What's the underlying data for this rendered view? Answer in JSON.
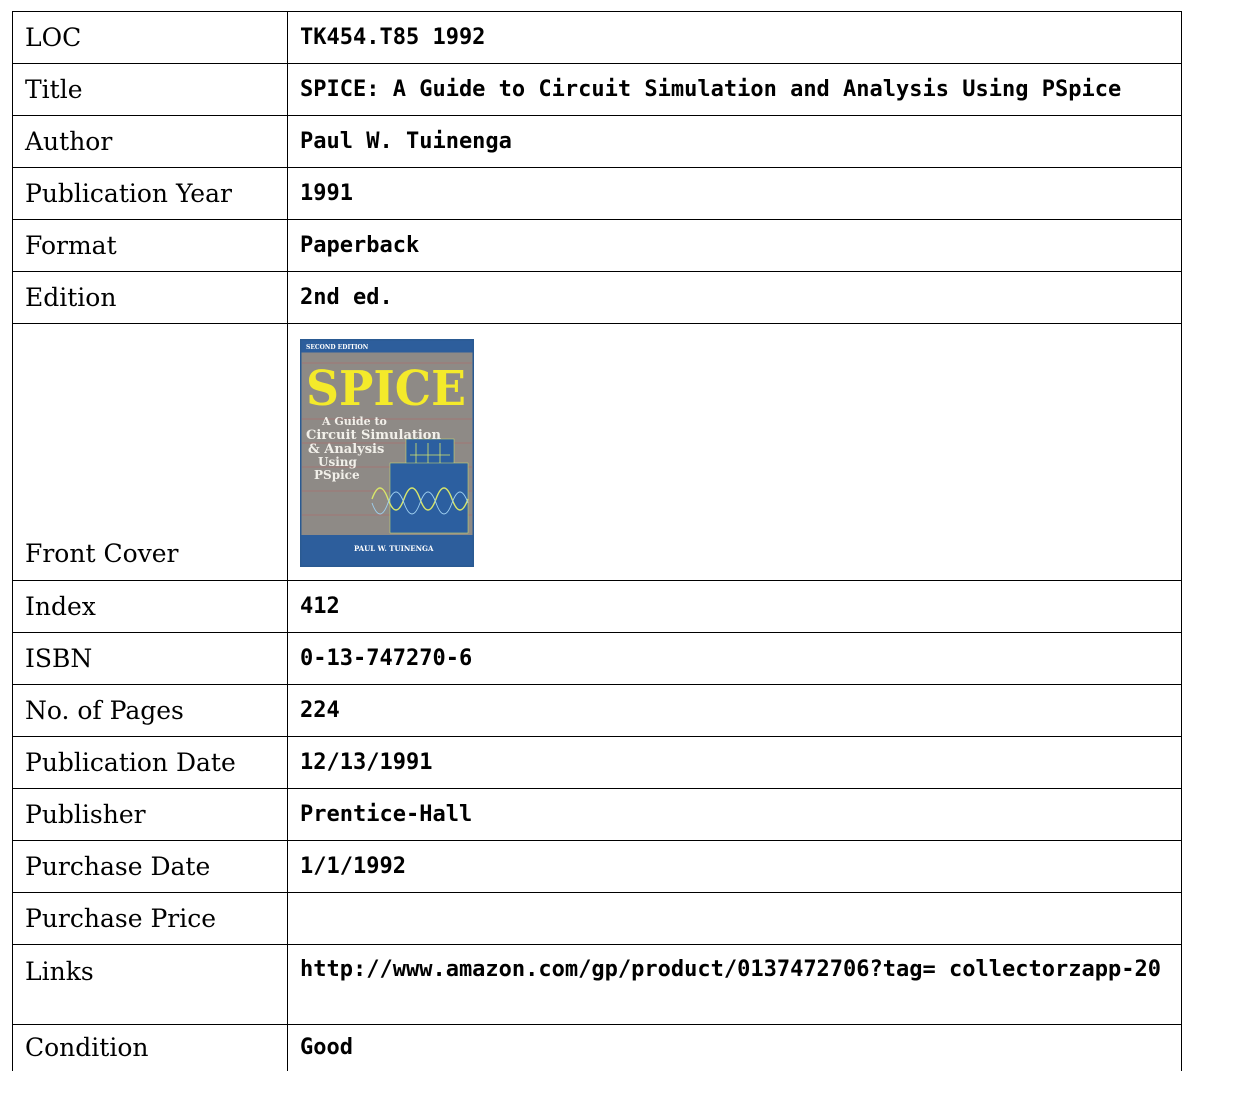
{
  "rows": [
    {
      "label": "LOC",
      "value": "TK454.T85 1992"
    },
    {
      "label": "Title",
      "value": "SPICE: A Guide to Circuit Simulation and Analysis Using PSpice"
    },
    {
      "label": "Author",
      "value": "Paul W. Tuinenga"
    },
    {
      "label": "Publication Year",
      "value": "1991"
    },
    {
      "label": "Format",
      "value": "Paperback"
    },
    {
      "label": "Edition",
      "value": "2nd ed."
    }
  ],
  "cover": {
    "label": "Front Cover",
    "edition_text": "SECOND EDITION",
    "big_title": "SPICE",
    "subtitle_lines": [
      "A Guide to",
      "Circuit Simulation",
      "& Analysis",
      "Using",
      "PSpice"
    ],
    "author_text": "PAUL W. TUINENGA",
    "colors": {
      "background": "#8e8a86",
      "border": "#2a5a92",
      "title": "#f4ea2a",
      "graph_panel": "#2c5fa0",
      "trace": "#d8e66a",
      "band": "#2d5e9c"
    }
  },
  "rows2": [
    {
      "label": "Index",
      "value": "412"
    },
    {
      "label": "ISBN",
      "value": "0-13-747270-6"
    },
    {
      "label": "No. of Pages",
      "value": "224"
    },
    {
      "label": "Publication Date",
      "value": "12/13/1991"
    },
    {
      "label": "Publisher",
      "value": "Prentice-Hall"
    },
    {
      "label": "Purchase Date",
      "value": "1/1/1992"
    },
    {
      "label": "Purchase Price",
      "value": ""
    }
  ],
  "links": {
    "label": "Links",
    "value": "http://www.amazon.com/gp/product/0137472706?tag= collectorzapp-20"
  },
  "condition": {
    "label": "Condition",
    "value": "Good"
  }
}
